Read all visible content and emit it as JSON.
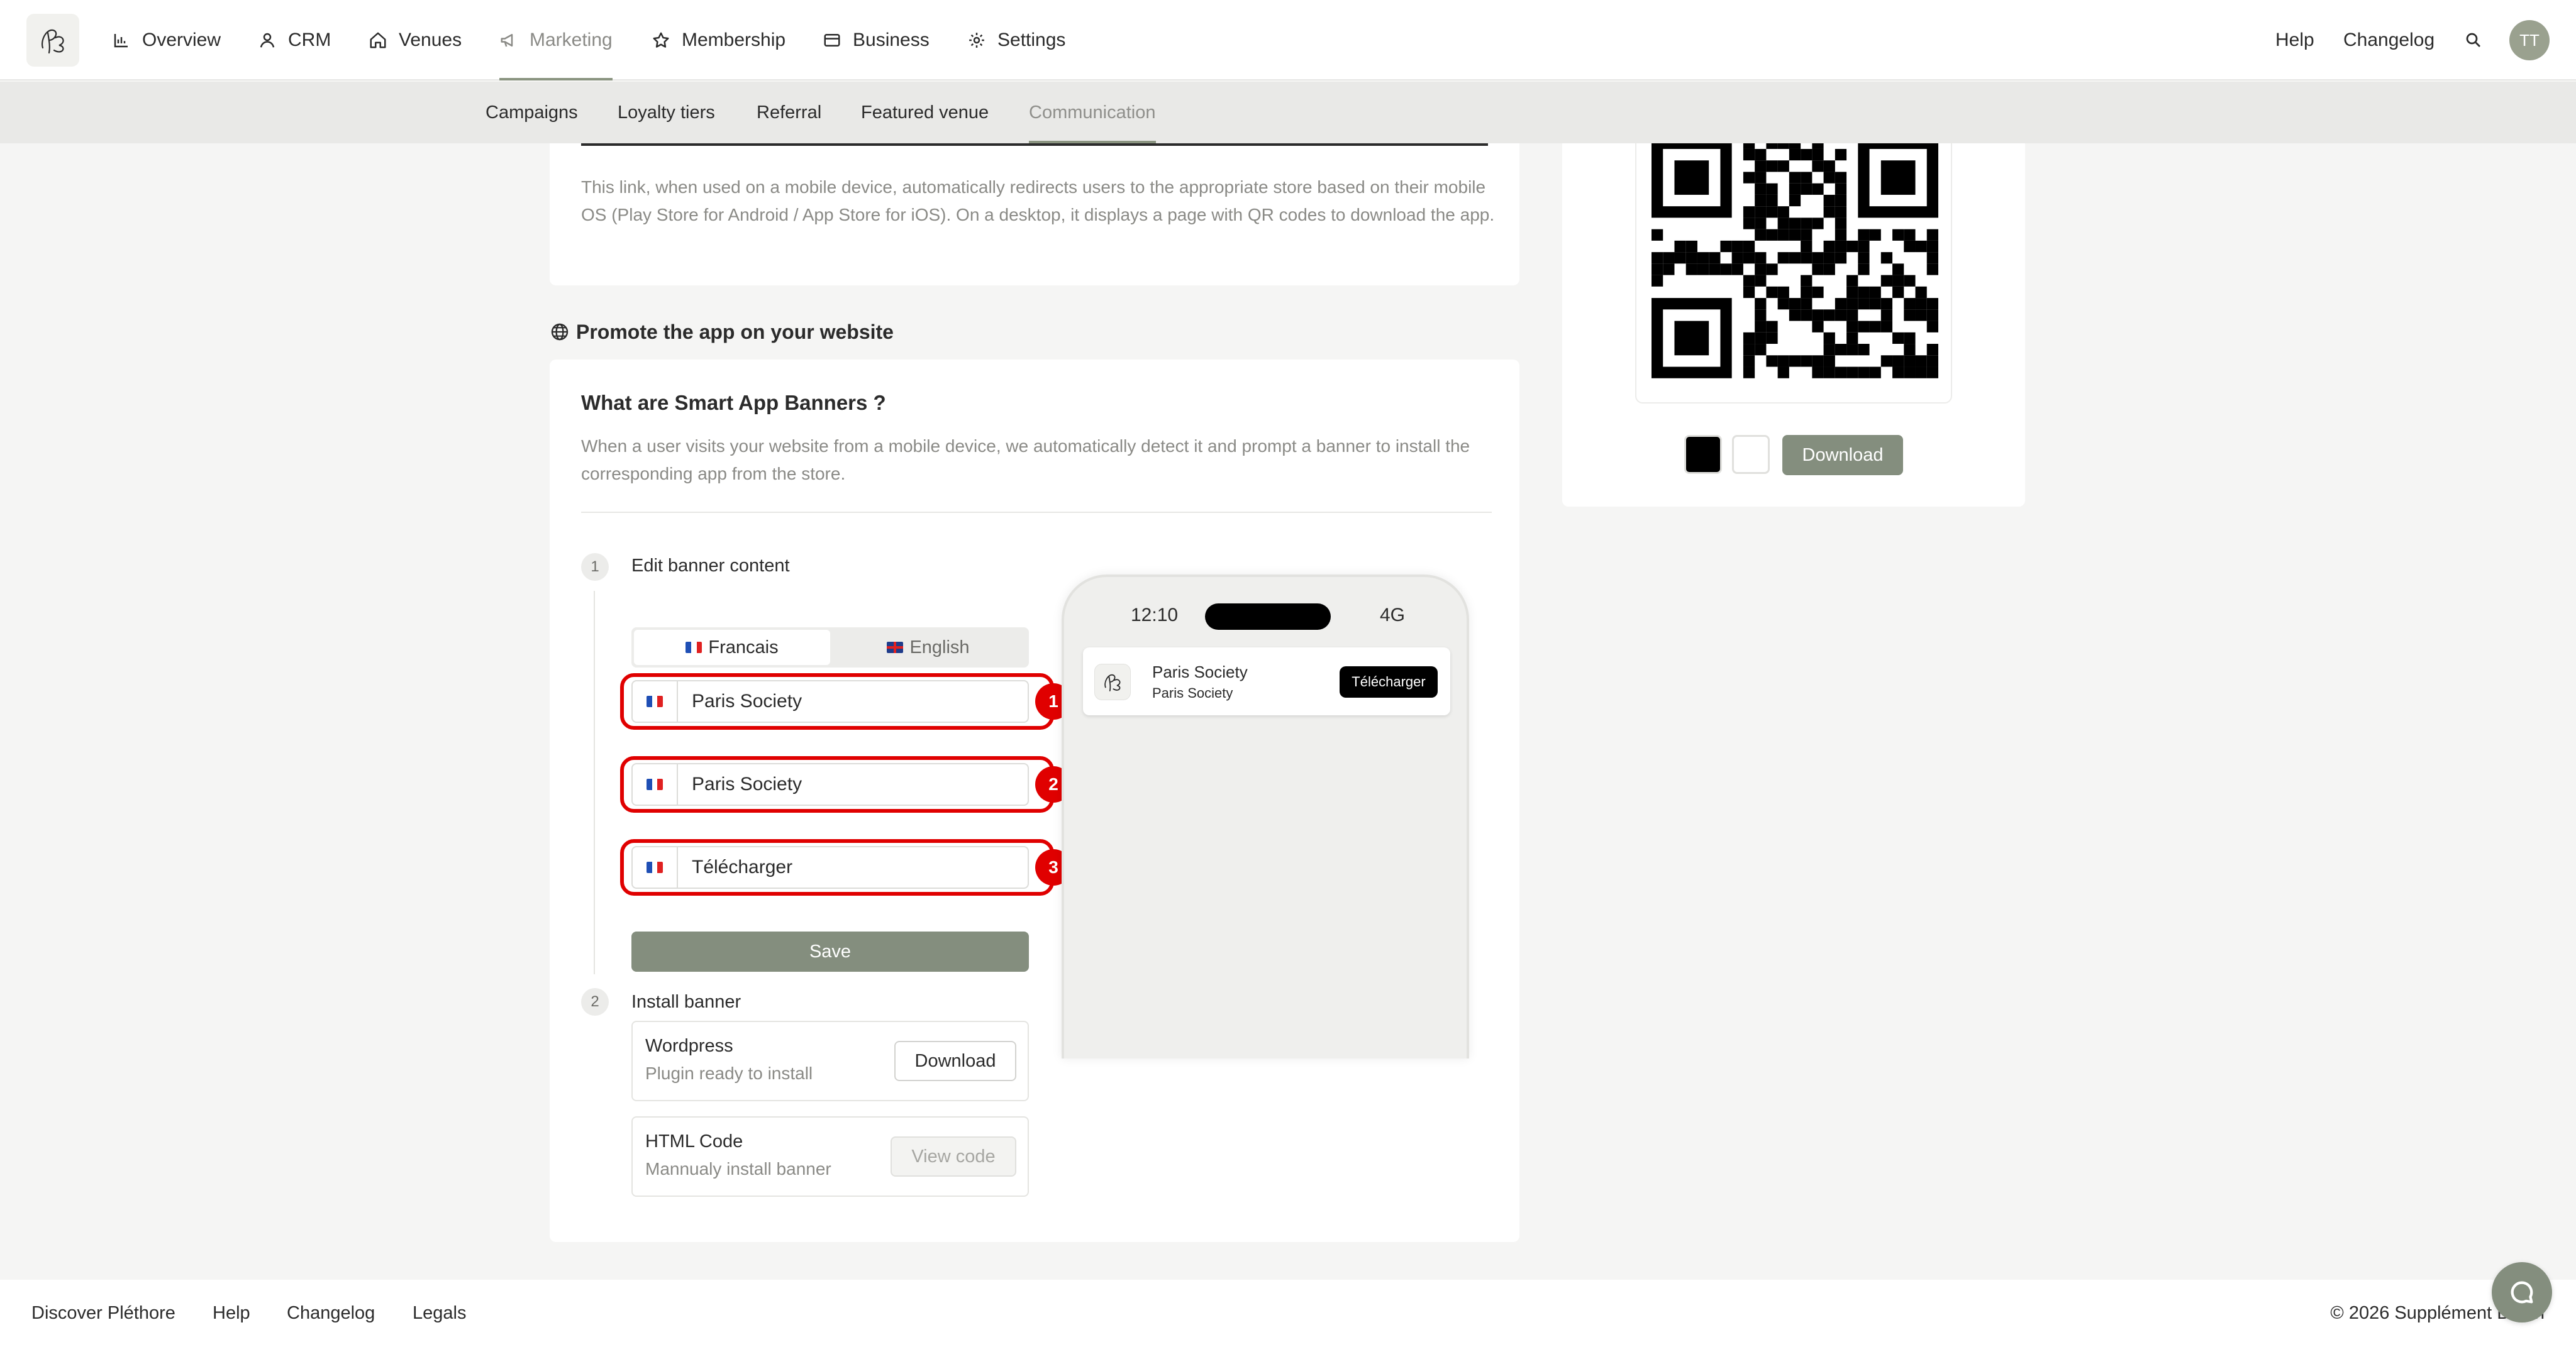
{
  "nav": {
    "items": [
      {
        "label": "Overview",
        "icon": "bar-chart-icon"
      },
      {
        "label": "CRM",
        "icon": "person-icon"
      },
      {
        "label": "Venues",
        "icon": "home-icon"
      },
      {
        "label": "Marketing",
        "icon": "megaphone-icon"
      },
      {
        "label": "Membership",
        "icon": "star-icon"
      },
      {
        "label": "Business",
        "icon": "wallet-icon"
      },
      {
        "label": "Settings",
        "icon": "gear-icon"
      }
    ],
    "active": "Marketing",
    "help": "Help",
    "changelog": "Changelog",
    "avatar": "TT"
  },
  "subnav": {
    "items": [
      "Campaigns",
      "Loyalty tiers",
      "Referral",
      "Featured venue",
      "Communication"
    ],
    "active": "Communication"
  },
  "link_card": {
    "description": "This link, when used on a mobile device, automatically redirects users to the appropriate store based on their mobile OS (Play Store for Android / App Store for iOS). On a desktop, it displays a page with QR codes to download the app."
  },
  "promote": {
    "heading": "Promote the app on your website",
    "card_title": "What are Smart App Banners ?",
    "card_desc": "When a user visits your website from a mobile device, we automatically detect it and prompt a banner to install the corresponding app from the store."
  },
  "step1": {
    "number": "1",
    "title": "Edit banner content",
    "lang_tabs": [
      "Francais",
      "English"
    ],
    "active_lang": "Francais",
    "fields": [
      {
        "value": "Paris Society",
        "badge": "1"
      },
      {
        "value": "Paris Society",
        "badge": "2"
      },
      {
        "value": "Télécharger",
        "badge": "3"
      }
    ],
    "save_label": "Save"
  },
  "step2": {
    "number": "2",
    "title": "Install banner",
    "options": [
      {
        "title": "Wordpress",
        "subtitle": "Plugin ready to install",
        "button": "Download"
      },
      {
        "title": "HTML Code",
        "subtitle": "Mannualy install banner",
        "button": "View code"
      }
    ]
  },
  "phone": {
    "time": "12:10",
    "network": "4G",
    "banner_title": "Paris Society",
    "banner_subtitle": "Paris Society",
    "banner_button": "Télécharger"
  },
  "qr": {
    "download_label": "Download",
    "swatches": [
      "#000000",
      "#ffffff"
    ]
  },
  "footer": {
    "links": [
      "Discover Pléthore",
      "Help",
      "Changelog",
      "Legals"
    ],
    "copyright": "© 2026 Supplément Béton"
  },
  "colors": {
    "accent": "#8a9480",
    "annotation": "#e00000",
    "primary_button": "#848e7e"
  }
}
